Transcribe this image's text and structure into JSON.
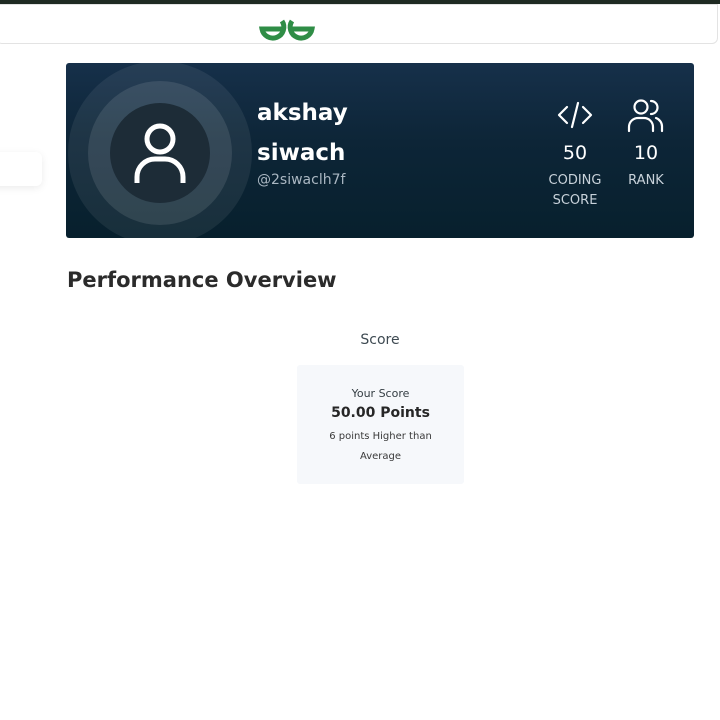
{
  "header": {
    "logo_icon": "geeksforgeeks-logo-icon",
    "logo_color": "#2f8d46"
  },
  "profile": {
    "avatar_icon": "user-icon",
    "name": "akshay siwach",
    "handle": "@2siwaclh7f",
    "stats": [
      {
        "icon": "code-icon",
        "value": "50",
        "label": "CODING\nSCORE"
      },
      {
        "icon": "users-icon",
        "value": "10",
        "label": "RANK"
      }
    ]
  },
  "performance": {
    "title": "Performance Overview",
    "score_label": "Score",
    "your_score_label": "Your Score",
    "points": "50.00 Points",
    "comparison": "6 points Higher than Average"
  }
}
